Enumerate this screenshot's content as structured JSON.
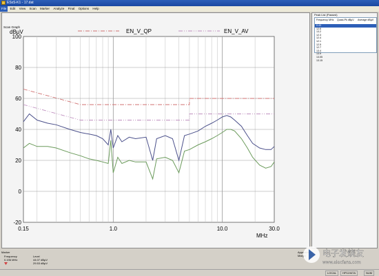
{
  "window": {
    "title": "ESxS-K1 - 17.dat"
  },
  "menu": [
    "File",
    "Edit",
    "View",
    "Scan",
    "Marker",
    "Analyze",
    "Final",
    "Options",
    "Help"
  ],
  "graph_panel": {
    "label": "Scan Graph"
  },
  "peak_list": {
    "title": "Peak List (Passed)",
    "headers": [
      "Frequency MHz",
      "Quasi-Pk dBµV",
      "Average dBµV"
    ],
    "rows": [
      "0.43",
      "12.6",
      "13.2",
      "12.3",
      "12.4",
      "12.1",
      "12.5",
      "12.7",
      "13.4",
      "13.9",
      "13.05",
      "13.15"
    ],
    "selected_index": 0
  },
  "marker": {
    "title": "Marker",
    "frequency_label": "Frequency",
    "frequency_value": "0.196 MHz",
    "level_label": "Level",
    "level_values": [
      "44.07 dBµV",
      "29.53 dBµV"
    ],
    "annotation": "Approximate Margin"
  },
  "statusbar": {
    "cells": [
      "LOCAL",
      "HP11947A",
      "NUM"
    ]
  },
  "watermark": {
    "text": "电子发烧友",
    "url": "www.elecfans.com"
  },
  "chart_data": {
    "type": "line",
    "ylabel": "dBµV",
    "xlabel": "MHz",
    "xscale": "log",
    "xlim": [
      0.15,
      30.0
    ],
    "ylim": [
      -20,
      100
    ],
    "yticks": [
      -20,
      0,
      20,
      40,
      60,
      80,
      100
    ],
    "xtick_labels": [
      "0.15",
      "1.0",
      "10.0",
      "30.0"
    ],
    "xtick_values": [
      0.15,
      1.0,
      10.0,
      30.0
    ],
    "grid": true,
    "legend_position": "top",
    "series": [
      {
        "name": "EN_V_QP",
        "color": "#d07070",
        "dash": "6,2,1,2",
        "points": [
          [
            0.15,
            66
          ],
          [
            0.5,
            56
          ],
          [
            5.0,
            56
          ],
          [
            5.0,
            60
          ],
          [
            30.0,
            60
          ]
        ]
      },
      {
        "name": "EN_V_AV",
        "color": "#c090c0",
        "dash": "6,2,1,2,1,2",
        "points": [
          [
            0.15,
            56
          ],
          [
            0.5,
            46
          ],
          [
            5.0,
            46
          ],
          [
            5.0,
            50
          ],
          [
            30.0,
            50
          ]
        ]
      },
      {
        "color": "#4a4f8a",
        "points": [
          [
            0.15,
            45
          ],
          [
            0.17,
            50
          ],
          [
            0.2,
            46
          ],
          [
            0.25,
            44
          ],
          [
            0.3,
            43
          ],
          [
            0.4,
            40
          ],
          [
            0.5,
            38
          ],
          [
            0.6,
            37
          ],
          [
            0.7,
            36
          ],
          [
            0.8,
            34
          ],
          [
            0.9,
            30
          ],
          [
            0.95,
            40
          ],
          [
            1.0,
            28
          ],
          [
            1.1,
            36
          ],
          [
            1.2,
            32
          ],
          [
            1.4,
            35
          ],
          [
            1.6,
            34
          ],
          [
            2.0,
            35
          ],
          [
            2.3,
            20
          ],
          [
            2.5,
            34
          ],
          [
            3.0,
            36
          ],
          [
            3.5,
            34
          ],
          [
            4.0,
            20
          ],
          [
            4.5,
            36
          ],
          [
            5.0,
            37
          ],
          [
            6.0,
            39
          ],
          [
            7.0,
            42
          ],
          [
            8.0,
            44
          ],
          [
            9.0,
            46
          ],
          [
            10.0,
            48
          ],
          [
            11.0,
            49
          ],
          [
            12.0,
            48
          ],
          [
            13.0,
            46
          ],
          [
            15.0,
            42
          ],
          [
            17.0,
            36
          ],
          [
            19.0,
            31
          ],
          [
            22.0,
            28
          ],
          [
            25.0,
            27
          ],
          [
            28.0,
            27
          ],
          [
            30.0,
            29
          ]
        ]
      },
      {
        "color": "#6a9a5a",
        "points": [
          [
            0.15,
            28
          ],
          [
            0.17,
            31
          ],
          [
            0.2,
            29
          ],
          [
            0.25,
            29
          ],
          [
            0.3,
            28
          ],
          [
            0.4,
            25
          ],
          [
            0.5,
            23
          ],
          [
            0.6,
            21
          ],
          [
            0.7,
            20
          ],
          [
            0.8,
            19
          ],
          [
            0.9,
            18
          ],
          [
            0.95,
            33
          ],
          [
            1.0,
            12
          ],
          [
            1.1,
            22
          ],
          [
            1.2,
            18
          ],
          [
            1.4,
            20
          ],
          [
            1.6,
            19
          ],
          [
            2.0,
            19
          ],
          [
            2.3,
            8
          ],
          [
            2.5,
            21
          ],
          [
            3.0,
            22
          ],
          [
            3.5,
            20
          ],
          [
            4.0,
            12
          ],
          [
            4.5,
            26
          ],
          [
            5.0,
            27
          ],
          [
            6.0,
            30
          ],
          [
            7.0,
            32
          ],
          [
            8.0,
            34
          ],
          [
            9.0,
            36
          ],
          [
            10.0,
            38
          ],
          [
            11.0,
            40
          ],
          [
            12.0,
            40
          ],
          [
            13.0,
            39
          ],
          [
            15.0,
            34
          ],
          [
            17.0,
            28
          ],
          [
            19.0,
            22
          ],
          [
            22.0,
            17
          ],
          [
            25.0,
            15
          ],
          [
            28.0,
            16
          ],
          [
            30.0,
            19
          ]
        ]
      }
    ]
  }
}
